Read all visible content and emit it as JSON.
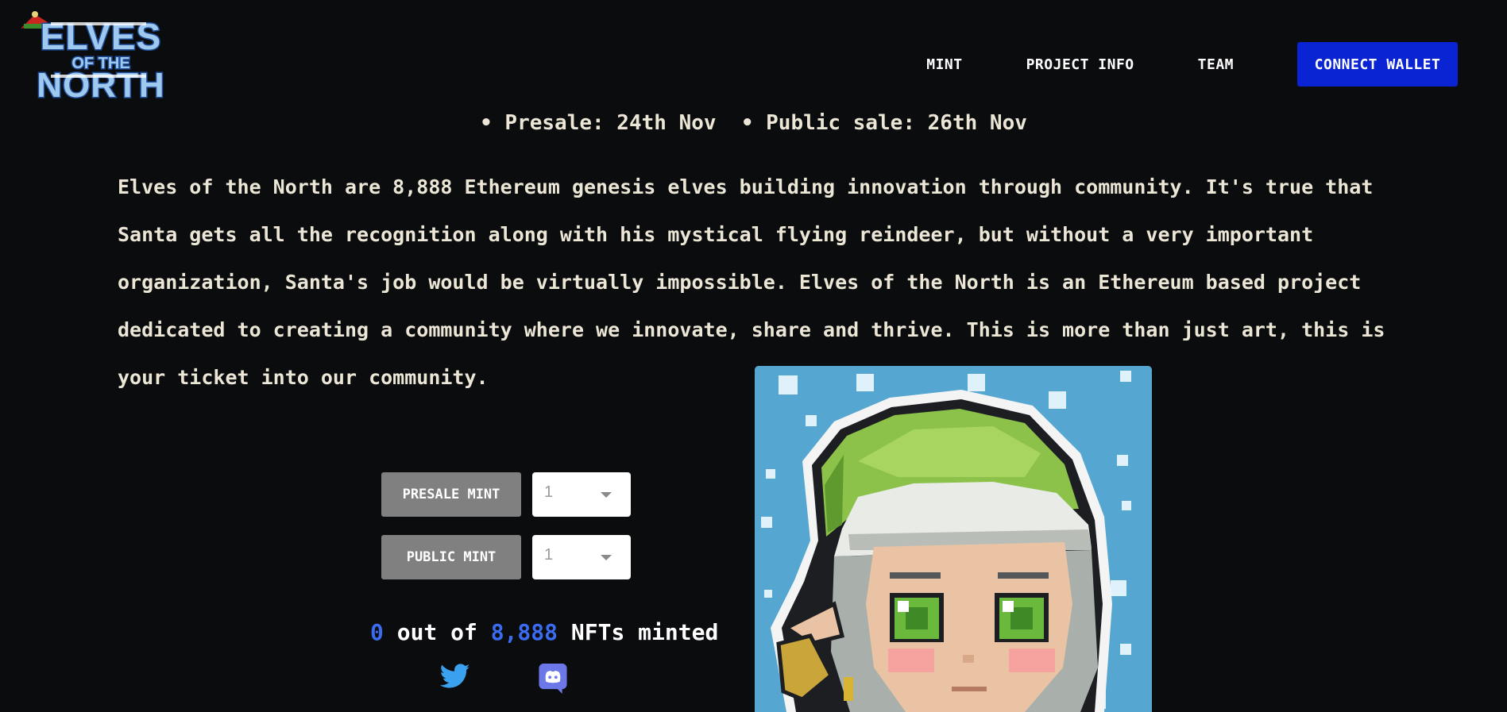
{
  "header": {
    "logo_text": "ELVES OF THE NORTH",
    "nav": [
      {
        "label": "MINT"
      },
      {
        "label": "PROJECT INFO"
      },
      {
        "label": "TEAM"
      }
    ],
    "connect_wallet_label": "CONNECT WALLET"
  },
  "sale_dates": "• Presale: 24th Nov  • Public sale: 26th Nov",
  "description": "Elves of the North are 8,888 Ethereum genesis elves building innovation through community. It's true that Santa gets all the recognition along with his mystical flying reindeer, but without a very important organization, Santa's job would be virtually impossible. Elves of the North is an Ethereum based project dedicated to creating a community where we innovate, share and thrive. This is more than just art, this is your ticket into our community.",
  "mint": {
    "presale_label": "PRESALE MINT",
    "presale_qty": "1",
    "public_label": "PUBLIC MINT",
    "public_qty": "1"
  },
  "minted": {
    "count": "0",
    "middle": " out of ",
    "total": "8,888",
    "suffix": " NFTs minted"
  },
  "social": {
    "twitter_icon": "twitter-icon",
    "discord_icon": "discord-icon"
  },
  "colors": {
    "background": "#0b0c0e",
    "accent_blue": "#0a24d4",
    "count_blue": "#3b6bf0",
    "mint_button": "#808080",
    "text": "#ece6d6"
  }
}
